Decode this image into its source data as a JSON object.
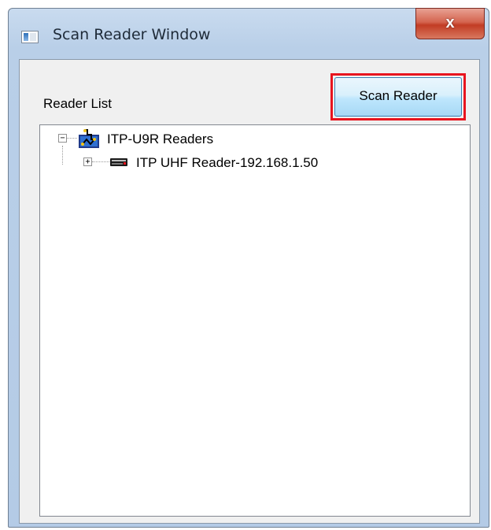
{
  "window": {
    "title": "Scan Reader Window",
    "close_label": "x"
  },
  "panel": {
    "reader_list_label": "Reader List",
    "scan_button_label": "Scan Reader"
  },
  "tree": {
    "root": {
      "label": "ITP-U9R Readers",
      "expander": "−",
      "icon": "network-readers-icon"
    },
    "children": [
      {
        "label": "ITP UHF Reader-192.168.1.50",
        "expander": "+",
        "icon": "rfid-reader-icon"
      }
    ]
  },
  "colors": {
    "highlight": "#e8141e",
    "close_button": "#c23c24",
    "titlebar": "#b9cfe8"
  }
}
